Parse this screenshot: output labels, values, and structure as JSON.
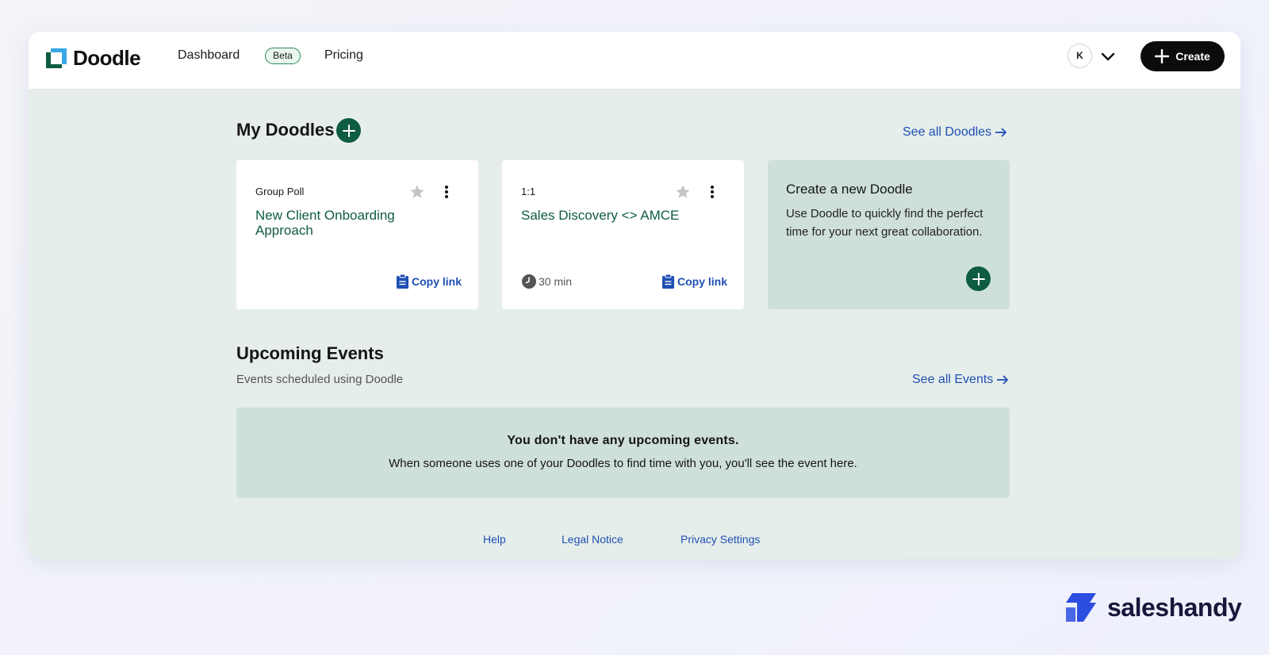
{
  "header": {
    "logo_text": "Doodle",
    "nav": {
      "dashboard": "Dashboard",
      "beta": "Beta",
      "pricing": "Pricing"
    },
    "avatar_initial": "K",
    "create_label": "Create"
  },
  "my_doodles": {
    "title": "My Doodles",
    "see_all": "See all Doodles",
    "cards": [
      {
        "type": "Group Poll",
        "title": "New Client Onboarding Approach",
        "copy_label": "Copy link"
      },
      {
        "type": "1:1",
        "title": "Sales Discovery <> AMCE",
        "duration": "30 min",
        "copy_label": "Copy link"
      }
    ],
    "create_card": {
      "title": "Create a new Doodle",
      "description": "Use Doodle to quickly find the perfect time for your next great collaboration."
    }
  },
  "upcoming_events": {
    "title": "Upcoming Events",
    "subtitle": "Events scheduled using Doodle",
    "see_all": "See all Events",
    "empty_title": "You don't have any upcoming events.",
    "empty_description": "When someone uses one of your Doodles to find time with you, you'll see the event here."
  },
  "footer": {
    "help": "Help",
    "legal": "Legal Notice",
    "privacy": "Privacy Settings"
  },
  "watermark": {
    "text": "saleshandy"
  },
  "colors": {
    "brand_green": "#0e5c41",
    "link_blue": "#1f4fb3",
    "page_bg": "#e6eeeb",
    "card_tint": "#cfdfda"
  }
}
